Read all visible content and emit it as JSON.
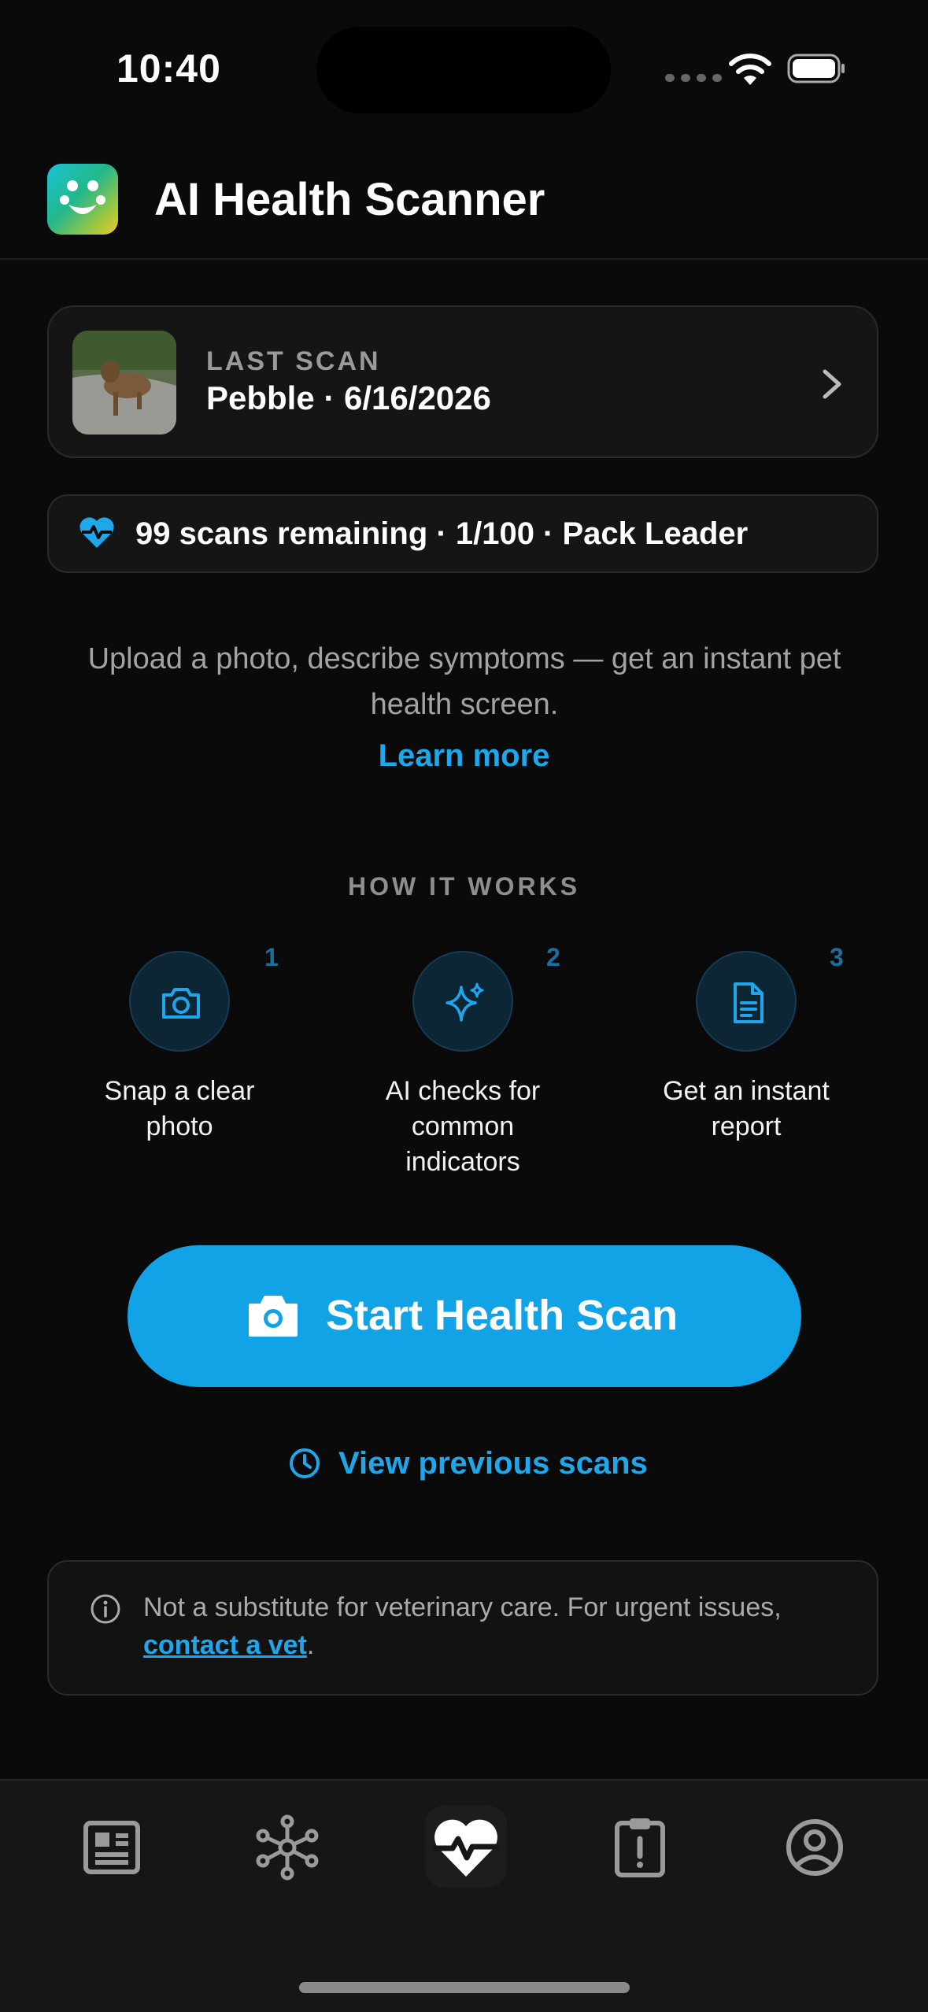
{
  "status_bar": {
    "time": "10:40"
  },
  "header": {
    "title": "AI Health Scanner"
  },
  "last_scan": {
    "label": "LAST SCAN",
    "value": "Pebble · 6/16/2026"
  },
  "scans_pill": {
    "text": "99 scans remaining · 1/100 · Pack Leader"
  },
  "intro": {
    "text": "Upload a photo, describe symptoms — get an instant pet health screen.",
    "learn_more": "Learn more"
  },
  "how_it_works": {
    "title": "HOW IT WORKS",
    "steps": [
      {
        "num": "1",
        "line1": "Snap a clear",
        "line2": "photo",
        "line3": "",
        "icon": "camera-icon"
      },
      {
        "num": "2",
        "line1": "AI checks for",
        "line2": "common",
        "line3": "indicators",
        "icon": "sparkles-icon"
      },
      {
        "num": "3",
        "line1": "Get an instant",
        "line2": "report",
        "line3": "",
        "icon": "document-icon"
      }
    ]
  },
  "cta": {
    "label": "Start Health Scan"
  },
  "previous": {
    "label": "View previous scans"
  },
  "disclaimer": {
    "text": "Not a substitute for veterinary care. For urgent issues,",
    "link": "contact a vet",
    "suffix": "."
  },
  "tabs": [
    {
      "name": "news-icon"
    },
    {
      "name": "network-icon"
    },
    {
      "name": "health-heart-icon",
      "active": true
    },
    {
      "name": "clipboard-alert-icon"
    },
    {
      "name": "profile-icon"
    }
  ],
  "colors": {
    "accent": "#12a2e6",
    "link": "#1ea7ea",
    "background": "#0a0a0a"
  }
}
